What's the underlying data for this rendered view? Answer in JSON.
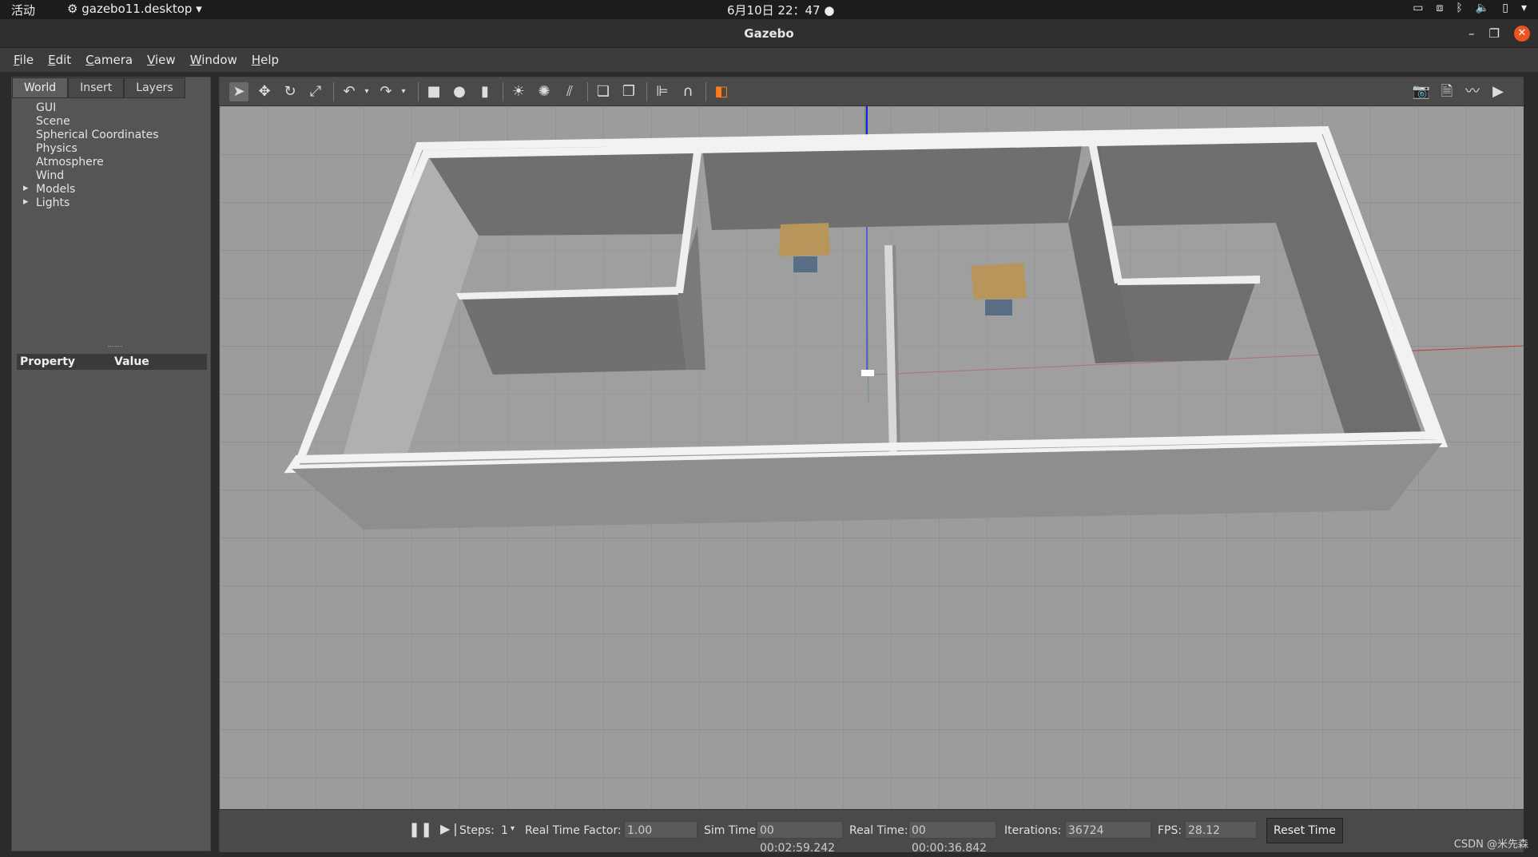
{
  "topbar": {
    "activities": "活动",
    "app_menu": "gazebo11.desktop",
    "clock": "6月10日 22：47"
  },
  "window": {
    "title": "Gazebo"
  },
  "menu": [
    "File",
    "Edit",
    "Camera",
    "View",
    "Window",
    "Help"
  ],
  "left_panel": {
    "tabs": [
      "World",
      "Insert",
      "Layers"
    ],
    "tree": [
      "GUI",
      "Scene",
      "Spherical Coordinates",
      "Physics",
      "Atmosphere",
      "Wind",
      "Models",
      "Lights"
    ],
    "property_header": {
      "property": "Property",
      "value": "Value"
    }
  },
  "toolbar": {
    "icons": [
      "select-arrow-icon",
      "translate-icon",
      "rotate-icon",
      "scale-icon",
      "undo-icon",
      "redo-icon",
      "box-icon",
      "sphere-icon",
      "cylinder-icon",
      "point-light-icon",
      "spot-light-icon",
      "directional-light-icon",
      "copy-icon",
      "paste-icon",
      "align-icon",
      "snap-icon",
      "view-angle-icon"
    ],
    "right_icons": [
      "screenshot-icon",
      "log-icon",
      "plot-icon",
      "record-video-icon"
    ]
  },
  "bottom": {
    "steps_label": "Steps:",
    "steps_value": "1",
    "rtf_label": "Real Time Factor:",
    "rtf_value": "1.00",
    "sim_time_label": "Sim Time:",
    "sim_time_value": "00 00:02:59.242",
    "real_time_label": "Real Time:",
    "real_time_value": "00 00:00:36.842",
    "iterations_label": "Iterations:",
    "iterations_value": "36724",
    "fps_label": "FPS:",
    "fps_value": "28.12",
    "reset_label": "Reset Time"
  },
  "watermark": "CSDN @米先森"
}
